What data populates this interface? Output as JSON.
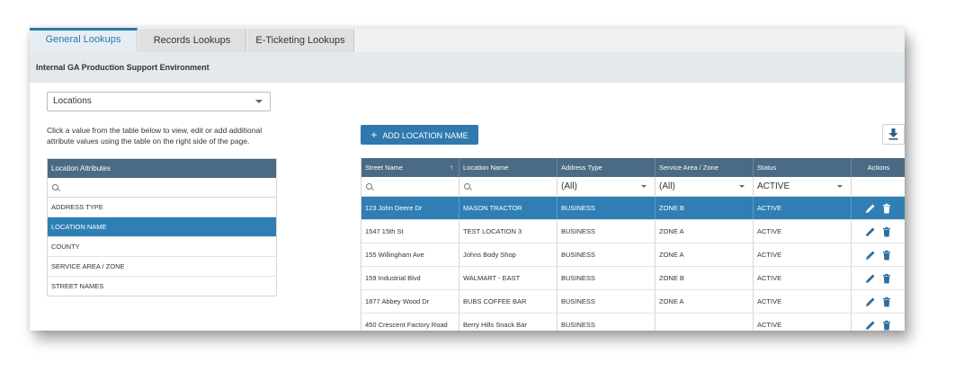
{
  "tabs": [
    {
      "label": "General Lookups",
      "active": true
    },
    {
      "label": "Records Lookups",
      "active": false
    },
    {
      "label": "E-Ticketing Lookups",
      "active": false
    }
  ],
  "environment": "Internal GA Production Support Environment",
  "lookup_select": {
    "value": "Locations"
  },
  "help_text": "Click a value from the table below to view, edit or add additional attribute values using the table on the right side of the page.",
  "left_table": {
    "header": "Location Attributes",
    "rows": [
      "ADDRESS TYPE",
      "LOCATION NAME",
      "COUNTY",
      "SERVICE AREA / ZONE",
      "STREET NAMES"
    ],
    "selected": "LOCATION NAME"
  },
  "add_button": {
    "label": "ADD LOCATION NAME"
  },
  "right_table": {
    "columns": [
      "Street Name",
      "Location Name",
      "Address Type",
      "Service Area / Zone",
      "Status",
      "Actions"
    ],
    "filters": {
      "address_type": "(All)",
      "service_area": "(All)",
      "status": "ACTIVE"
    },
    "rows": [
      [
        "123 John Deere Dr",
        "MASON TRACTOR",
        "BUSINESS",
        "ZONE B",
        "ACTIVE"
      ],
      [
        "1547 15th St",
        "TEST LOCATION 3",
        "BUSINESS",
        "ZONE A",
        "ACTIVE"
      ],
      [
        "155 Willingham Ave",
        "Johns Body Shop",
        "BUSINESS",
        "ZONE A",
        "ACTIVE"
      ],
      [
        "159 Industrial Blvd",
        "WALMART - EAST",
        "BUSINESS",
        "ZONE B",
        "ACTIVE"
      ],
      [
        "1877 Abbey Wood Dr",
        "BUBS COFFEE BAR",
        "BUSINESS",
        "ZONE A",
        "ACTIVE"
      ],
      [
        "450 Crescent Factory Road",
        "Berry Hills Snack Bar",
        "BUSINESS",
        "",
        "ACTIVE"
      ]
    ]
  },
  "colors": {
    "accent": "#2f7fb5",
    "header": "#4a6a85"
  }
}
